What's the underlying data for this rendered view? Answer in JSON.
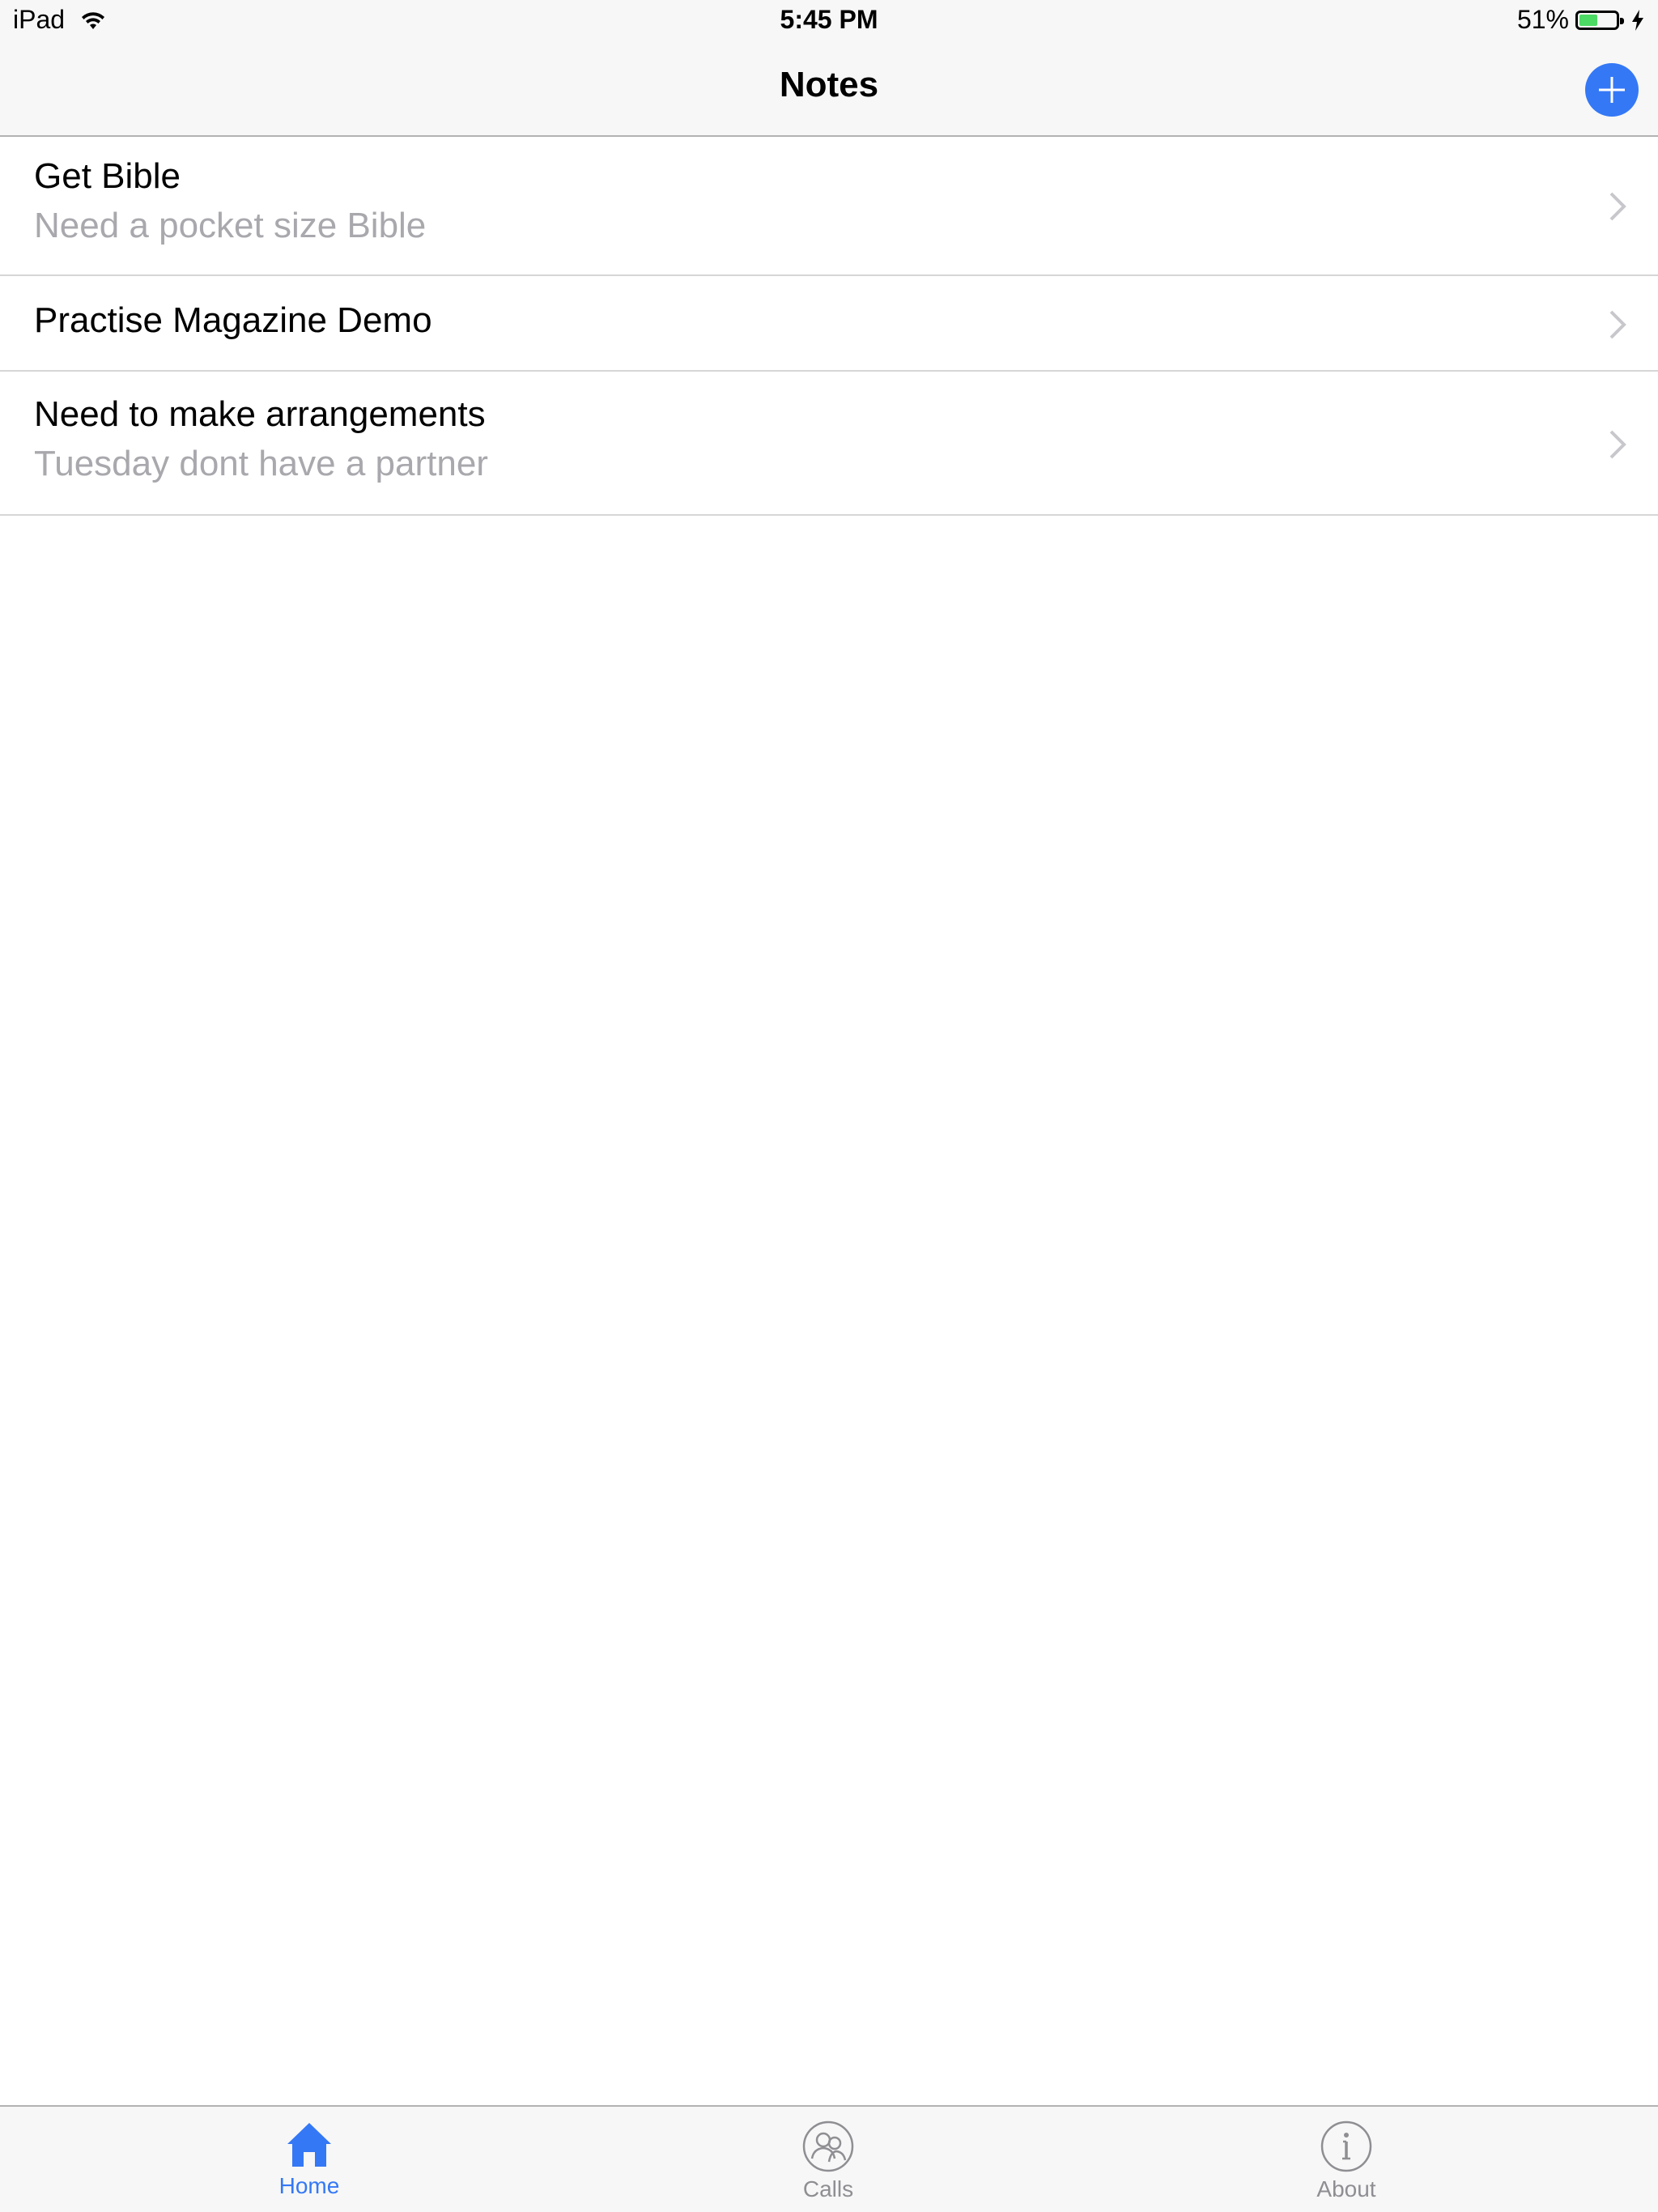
{
  "status_bar": {
    "device": "iPad",
    "time": "5:45 PM",
    "battery": "51%",
    "battery_level": 0.51,
    "wifi_icon": "wifi-icon",
    "charging_icon": "bolt-icon"
  },
  "nav": {
    "title": "Notes",
    "add_icon": "plus-icon"
  },
  "notes": [
    {
      "title": "Get Bible",
      "subtitle": "Need a pocket size Bible"
    },
    {
      "title": "Practise Magazine Demo",
      "subtitle": ""
    },
    {
      "title": "Need to make arrangements",
      "subtitle": "Tuesday dont have a partner"
    }
  ],
  "tabs": [
    {
      "label": "Home",
      "icon": "home-icon",
      "selected": true
    },
    {
      "label": "Calls",
      "icon": "people-icon",
      "selected": false
    },
    {
      "label": "About",
      "icon": "info-icon",
      "selected": false
    }
  ],
  "colors": {
    "accent": "#3478f6",
    "tab_inactive": "#8e8e93",
    "subtitle": "#a8a8ad",
    "battery_green": "#4cd964"
  }
}
